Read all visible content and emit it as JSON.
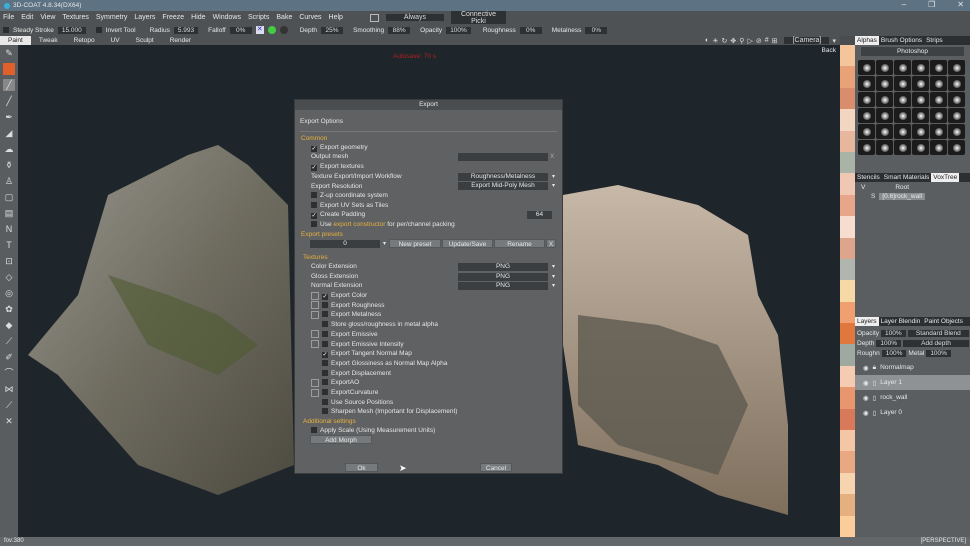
{
  "window": {
    "title": "3D-COAT 4.8.34(DX64)",
    "minimize": "–",
    "restore": "❐",
    "close": "✕"
  },
  "menu": [
    "File",
    "Edit",
    "View",
    "Textures",
    "Symmetry",
    "Layers",
    "Freeze",
    "Hide",
    "Windows",
    "Scripts",
    "Bake",
    "Curves",
    "Help"
  ],
  "menu_extras": {
    "always": "Always",
    "connective": "Connective Picki"
  },
  "toolbar": {
    "steady_stroke": "Steady Stroke",
    "steady_value": "15.000",
    "invert_tool": "Invert Tool",
    "radius": "Radius",
    "radius_value": "5.993",
    "falloff": "Falloff",
    "falloff_value": "0%",
    "depth": "Depth",
    "depth_value": "25%",
    "smoothing": "Smoothing",
    "smoothing_value": "88%",
    "opacity": "Opacity",
    "opacity_value": "100%",
    "roughness": "Roughness",
    "roughness_value": "0%",
    "metalness": "Metalness",
    "metalness_value": "0%"
  },
  "tabs": [
    "Paint",
    "Tweak",
    "Retopo",
    "UV",
    "Sculpt",
    "Render"
  ],
  "viewport": {
    "camera": "[Camera]",
    "back": "Back",
    "overlay": "Autosave: 70 s"
  },
  "right_panel": {
    "tabs_top": [
      "Alphas",
      "Brush Options",
      "Strips"
    ],
    "preset": "Photoshop",
    "tabs_mid": [
      "Stencils",
      "Smart Materials",
      "VoxTree"
    ],
    "voxtree": [
      {
        "flag": "V",
        "name": "Root"
      },
      {
        "flag": "S",
        "name": "[0.6]rock_wall"
      }
    ],
    "tabs_layers": [
      "Layers",
      "Layer Blendin",
      "Paint Objects"
    ],
    "opacity_label": "Opacity",
    "opacity": "100%",
    "blend": "Standard Blend",
    "depth_label": "Depth",
    "depth": "100%",
    "depth_mode": "Add depth",
    "rough_label": "Roughn",
    "rough": "100%",
    "metal_label": "Metal",
    "metal": "100%",
    "layers": [
      "Normalmap",
      "Layer 1",
      "rock_wall",
      "Layer 0"
    ]
  },
  "status": {
    "fov": "fov:380",
    "mode": "[PERSPECTIVE]"
  },
  "dialog": {
    "title": "Export",
    "subtitle": "Export Options",
    "common": "Common",
    "export_geometry": "Export geometry",
    "output_mesh": "Output mesh",
    "clear": "X",
    "export_textures": "Export textures",
    "workflow_label": "Texture Export/Import Workflow",
    "workflow": "Roughness/Metalness",
    "resolution_label": "Export Resolution",
    "resolution": "Export Mid-Poly Mesh",
    "zup": "Z-up coordinate system",
    "uv_tiles": "Export UV Sets as Tiles",
    "padding": "Create Padding",
    "padding_value": "64",
    "use": "Use",
    "constructor": "export constructor",
    "constructor_rest": "for per/channel packing",
    "presets": "Export presets",
    "preset_value": "0",
    "new_preset": "New preset",
    "update": "Update/Save",
    "rename": "Rename",
    "delete": "X",
    "textures": "Textures",
    "color_ext": "Color Extension",
    "gloss_ext": "Gloss Extension",
    "normal_ext": "Normal Extension",
    "ext_value": "PNG",
    "items": [
      {
        "label": "Export Color",
        "checked": true,
        "curve": true
      },
      {
        "label": "Export Roughness",
        "checked": false,
        "curve": true
      },
      {
        "label": "Export Metalness",
        "checked": false,
        "curve": true
      },
      {
        "label": "Store gloss/roughness in metal alpha",
        "checked": false,
        "curve": false
      },
      {
        "label": "Export Emissive",
        "checked": false,
        "curve": true
      },
      {
        "label": "Export Emissive Intensity",
        "checked": false,
        "curve": true
      },
      {
        "label": "Export Tangent Normal Map",
        "checked": true,
        "curve": false
      },
      {
        "label": "Export Glossiness as Normal Map Alpha",
        "checked": false,
        "curve": false
      },
      {
        "label": "Export Displacement",
        "checked": false,
        "curve": false
      },
      {
        "label": "ExportAO",
        "checked": false,
        "curve": true
      },
      {
        "label": "ExportCurvature",
        "checked": false,
        "curve": true
      },
      {
        "label": "Use Source Positions",
        "checked": false,
        "curve": false
      },
      {
        "label": "Sharpen Mesh (Important for Displacement)",
        "checked": false,
        "curve": false
      }
    ],
    "additional": "Additional settings",
    "apply_scale": "Apply Scale (Using Measurement Units)",
    "add_morph": "Add Morph",
    "ok": "Ok",
    "cancel": "Cancel"
  }
}
